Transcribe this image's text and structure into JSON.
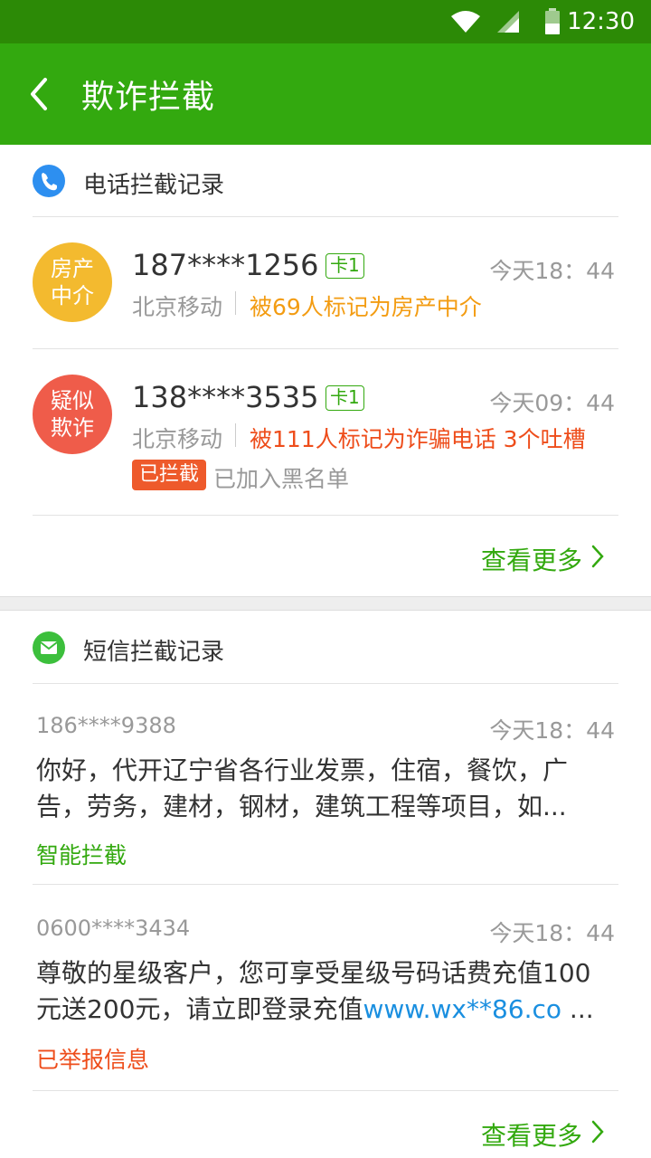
{
  "status_bar": {
    "time": "12:30"
  },
  "app_bar": {
    "title": "欺诈拦截"
  },
  "call_section": {
    "title": "电话拦截记录",
    "records": [
      {
        "avatar_line1": "房产",
        "avatar_line2": "中介",
        "avatar_color": "#f3ba2f",
        "number": "187****1256",
        "card": "卡1",
        "time": "今天18：44",
        "carrier": "北京移动",
        "mark": "被69人标记为房产中介",
        "mark_color": "#f39c12"
      },
      {
        "avatar_line1": "疑似",
        "avatar_line2": "欺诈",
        "avatar_color": "#ef5c4a",
        "number": "138****3535",
        "card": "卡1",
        "time": "今天09：44",
        "carrier": "北京移动",
        "mark": "被111人标记为诈骗电话  3个吐槽",
        "mark_color": "#ee4d1b",
        "blocked_label": "已拦截",
        "blacklist_text": "已加入黑名单"
      }
    ],
    "see_more": "查看更多"
  },
  "sms_section": {
    "title": "短信拦截记录",
    "records": [
      {
        "sender": "186****9388",
        "time": "今天18：44",
        "body_line1": "你好，代开辽宁省各行业发票，住宿，餐饮，广",
        "body_line2": "告，劳务，建材，钢材，建筑工程等项目，如...",
        "tag": "智能拦截",
        "tag_color": "#33a90f"
      },
      {
        "sender": "0600****3434",
        "time": "今天18：44",
        "body_line1": "尊敬的星级客户，您可享受星级号码话费充值100",
        "body_line2_text": "元送200元，请立即登录充值",
        "body_line2_link": "www.wx**86.co",
        "body_line2_tail": " ...",
        "tag": "已举报信息",
        "tag_color": "#ee4d1b"
      }
    ],
    "see_more": "查看更多"
  },
  "colors": {
    "accent": "#33a90f",
    "status_bar": "#2c8a06",
    "phone_icon": "#2d8ff0",
    "sms_icon": "#3cbf3c"
  },
  "icons": {
    "back": "chevron-left-icon",
    "phone": "phone-icon",
    "sms": "envelope-icon",
    "more": "chevron-right-icon"
  }
}
